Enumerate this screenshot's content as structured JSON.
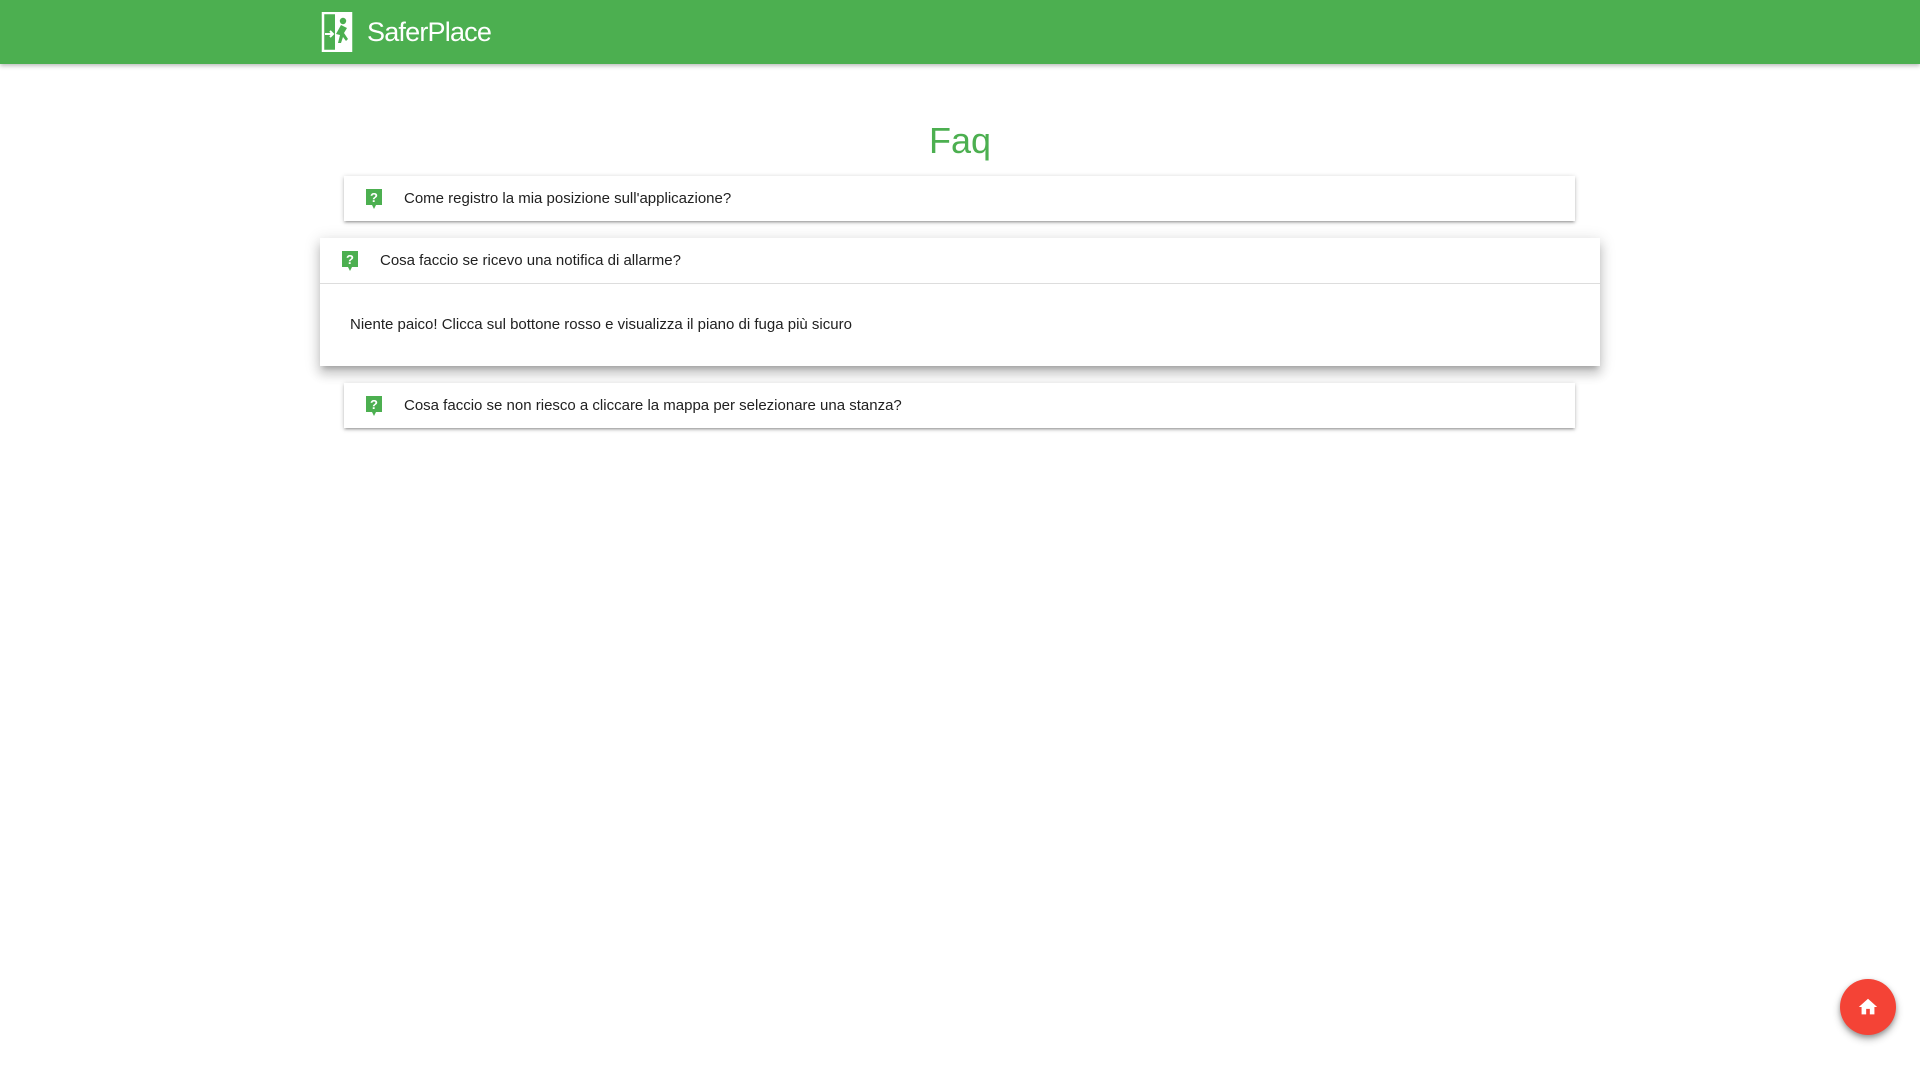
{
  "header": {
    "brand_name": "SaferPlace",
    "logo_icon": "emergency-exit-icon",
    "background_color": "#4caf50"
  },
  "page": {
    "title": "Faq",
    "title_color": "#4caf50"
  },
  "faq": {
    "icon": "question-mark-icon",
    "items": [
      {
        "question": "Come registro la mia posizione sull'applicazione?",
        "expanded": false
      },
      {
        "question": "Cosa faccio se ricevo una notifica di allarme?",
        "answer": "Niente paico! Clicca sul bottone rosso e visualizza il piano di fuga più sicuro",
        "expanded": true
      },
      {
        "question": "Cosa faccio se non riesco a cliccare la mappa per selezionare una stanza?",
        "expanded": false
      }
    ]
  },
  "fab": {
    "icon": "home-icon",
    "color": "#f44336"
  }
}
